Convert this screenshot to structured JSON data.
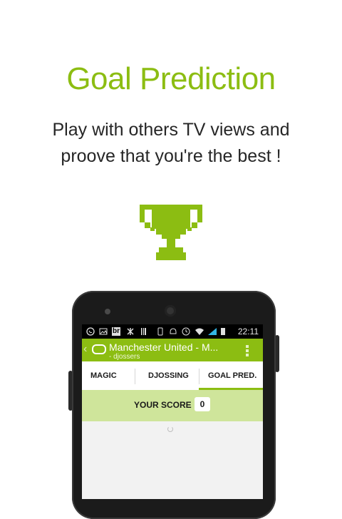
{
  "headline": "Goal Prediction",
  "description": {
    "line1": "Play with others TV views and",
    "line2": "proove that you're the best !"
  },
  "colors": {
    "accent": "#8cbd12",
    "score_bar": "#cfe59b"
  },
  "icons": {
    "hero": "trophy-icon"
  },
  "device": {
    "status_bar": {
      "time": "22:11",
      "icons": [
        "whatsapp-icon",
        "image-icon",
        "br-icon",
        "sport-icon",
        "barcode-icon",
        "vibrate-icon",
        "alarm-icon",
        "clock-icon",
        "wifi-icon",
        "signal-icon",
        "battery-icon"
      ],
      "br_text": "br"
    },
    "action_bar": {
      "title": "Manchester United - M...",
      "subtitle": "- djossers"
    },
    "tabs": [
      "MAGIC",
      "DJOSSING",
      "GOAL PRED."
    ],
    "active_tab": "GOAL PRED.",
    "score": {
      "label": "YOUR SCORE",
      "value": "0"
    }
  }
}
